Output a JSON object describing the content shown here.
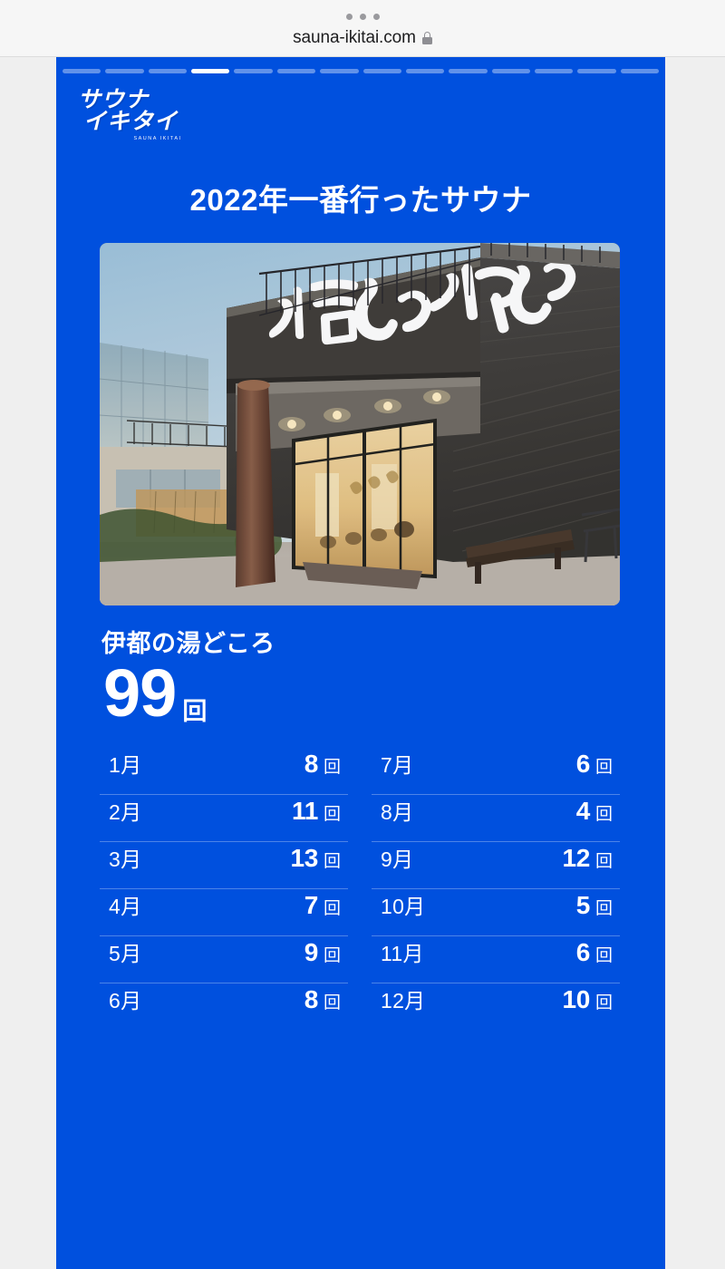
{
  "browser": {
    "url": "sauna-ikitai.com",
    "lock_icon": "lock-icon",
    "menu_dots": "more-dots-icon"
  },
  "story": {
    "progress": {
      "total_segments": 14,
      "active_index": 4
    },
    "logo": {
      "line1": "サウナ",
      "line2": "イキタイ",
      "subtitle": "SAUNA IKITAI"
    },
    "title": "2022年一番行ったサウナ",
    "hero_photo_alt": "伊都の湯どころ 外観",
    "facility_name": "伊都の湯どころ",
    "total_visits_number": "99",
    "total_visits_unit": "回",
    "months": [
      {
        "label": "1月",
        "count": "8",
        "unit": "回"
      },
      {
        "label": "2月",
        "count": "11",
        "unit": "回"
      },
      {
        "label": "3月",
        "count": "13",
        "unit": "回"
      },
      {
        "label": "4月",
        "count": "7",
        "unit": "回"
      },
      {
        "label": "5月",
        "count": "9",
        "unit": "回"
      },
      {
        "label": "6月",
        "count": "8",
        "unit": "回"
      },
      {
        "label": "7月",
        "count": "6",
        "unit": "回"
      },
      {
        "label": "8月",
        "count": "4",
        "unit": "回"
      },
      {
        "label": "9月",
        "count": "12",
        "unit": "回"
      },
      {
        "label": "10月",
        "count": "5",
        "unit": "回"
      },
      {
        "label": "11月",
        "count": "6",
        "unit": "回"
      },
      {
        "label": "12月",
        "count": "10",
        "unit": "回"
      }
    ]
  },
  "colors": {
    "brand_blue": "#0050de",
    "page_background": "#efefef",
    "browser_bar": "#f6f6f6",
    "text_on_brand": "#ffffff"
  }
}
